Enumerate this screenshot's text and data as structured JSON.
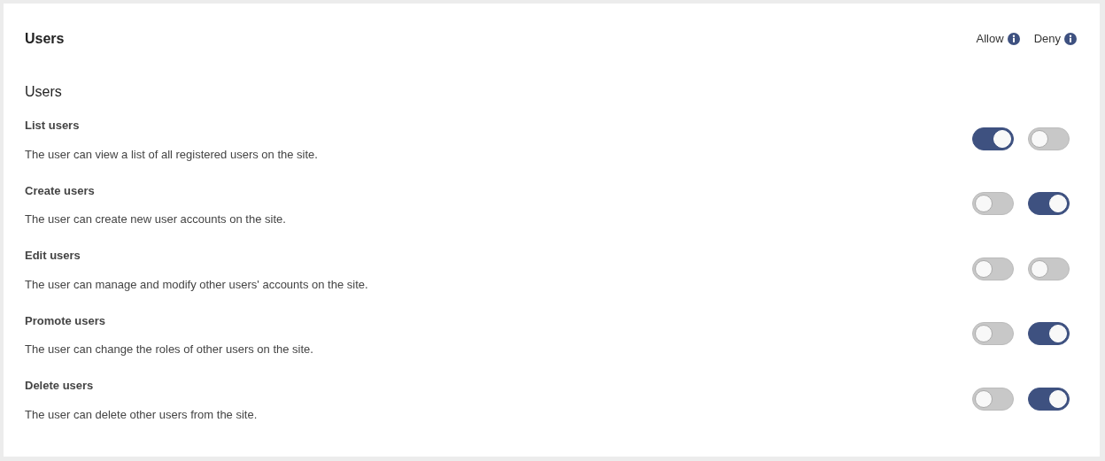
{
  "title": "Users",
  "columns": [
    "Allow",
    "Deny"
  ],
  "section": "Users",
  "permissions": [
    {
      "name": "List users",
      "description": "The user can view a list of all registered users on the site.",
      "allow": true,
      "deny": false
    },
    {
      "name": "Create users",
      "description": "The user can create new user accounts on the site.",
      "allow": false,
      "deny": true
    },
    {
      "name": "Edit users",
      "description": "The user can manage and modify other users' accounts on the site.",
      "allow": false,
      "deny": false
    },
    {
      "name": "Promote users",
      "description": "The user can change the roles of other users on the site.",
      "allow": false,
      "deny": true
    },
    {
      "name": "Delete users",
      "description": "The user can delete other users from the site.",
      "allow": false,
      "deny": true
    }
  ]
}
